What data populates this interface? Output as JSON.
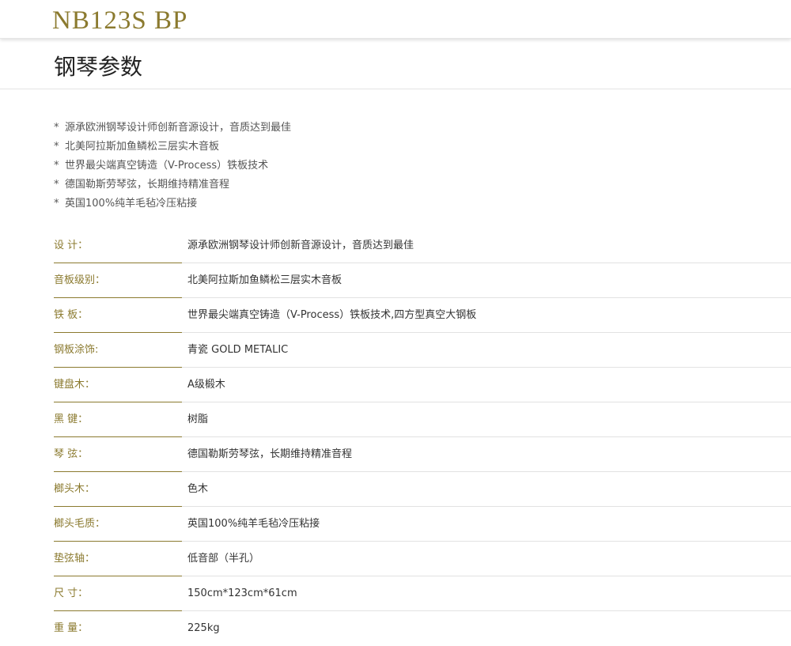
{
  "header": {
    "model": "NB123S BP"
  },
  "section": {
    "title": "钢琴参数"
  },
  "features": [
    "源承欧洲钢琴设计师创新音源设计，音质达到最佳",
    "北美阿拉斯加鱼鳞松三层实木音板",
    "世界最尖端真空铸造（V-Process）铁板技术",
    "德国勒斯劳琴弦，长期维持精准音程",
    "英国100%纯羊毛毡冷压粘接"
  ],
  "feature_bullet": "*",
  "specs": [
    {
      "label": "设 计：",
      "value": "源承欧洲钢琴设计师创新音源设计，音质达到最佳"
    },
    {
      "label": "音板级别：",
      "value": "北美阿拉斯加鱼鳞松三层实木音板"
    },
    {
      "label": "铁 板：",
      "value": "世界最尖端真空铸造（V-Process）铁板技术,四方型真空大钢板"
    },
    {
      "label": "钢板涂饰:",
      "value": "青瓷 GOLD METALIC"
    },
    {
      "label": "键盘木：",
      "value": "A级椴木"
    },
    {
      "label": "黑 键：",
      "value": "树脂"
    },
    {
      "label": "琴 弦：",
      "value": "德国勒斯劳琴弦，长期维持精准音程"
    },
    {
      "label": "榔头木：",
      "value": "色木"
    },
    {
      "label": "榔头毛质：",
      "value": "英国100%纯羊毛毡冷压粘接"
    },
    {
      "label": "垫弦轴：",
      "value": "低音部（半孔）"
    },
    {
      "label": "尺 寸：",
      "value": "150cm*123cm*61cm"
    },
    {
      "label": "重 量：",
      "value": "225kg"
    }
  ],
  "colors": {
    "accent_gold": "#8b7a2f",
    "text_dark": "#333333",
    "text_muted": "#555555",
    "divider": "#e2e2e2"
  }
}
